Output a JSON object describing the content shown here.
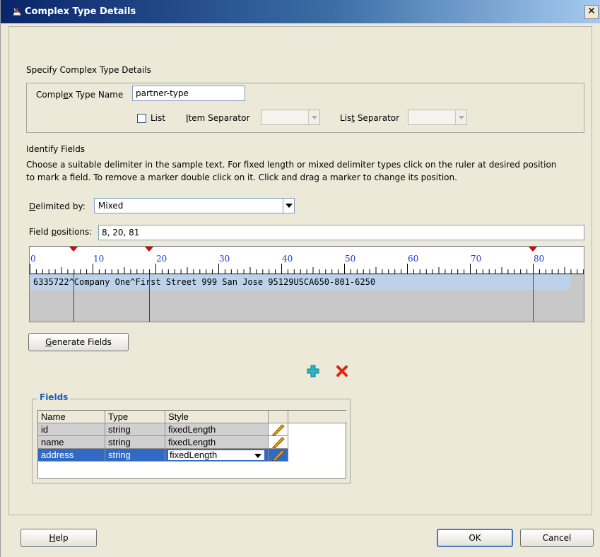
{
  "window": {
    "title": "Complex Type Details",
    "close_glyph": "✕"
  },
  "header": {
    "section_title": "Specify Complex Type Details"
  },
  "complex_type": {
    "name_label": "Complex Type Name",
    "name_value": "partner-type",
    "list_label": "List",
    "list_checked": false,
    "item_separator_label": "Item Separator",
    "item_separator_value": "",
    "list_separator_label": "List Separator",
    "list_separator_value": ""
  },
  "identify": {
    "title": "Identify Fields",
    "instructions_line1": "Choose a suitable delimiter in the sample text. For fixed length or mixed delimiter types click on the ruler at desired position",
    "instructions_line2": "to mark a field. To remove a marker double click on it. Click and drag a marker to change its position.",
    "delimited_by_label": "Delimited by:",
    "delimited_by_value": "Mixed",
    "field_positions_label": "Field positions:",
    "field_positions_value": "8, 20, 81"
  },
  "ruler": {
    "tick_labels": [
      "0",
      "10",
      "20",
      "30",
      "40",
      "50",
      "60",
      "70",
      "80"
    ],
    "sample_text": "6335722^Company One^First Street    999       San Jose       95129USCA650-801-6250",
    "markers": [
      8,
      20,
      81
    ]
  },
  "buttons": {
    "generate_fields": "Generate Fields",
    "help": "Help",
    "ok": "OK",
    "cancel": "Cancel"
  },
  "fields": {
    "legend": "Fields",
    "add_icon": "plus-icon",
    "delete_icon": "delete-x-icon",
    "columns": [
      "Name",
      "Type",
      "Style",
      ""
    ],
    "rows": [
      {
        "name": "id",
        "type": "string",
        "style": "fixedLength",
        "selected": false
      },
      {
        "name": "name",
        "type": "string",
        "style": "fixedLength",
        "selected": false
      },
      {
        "name": "address",
        "type": "string",
        "style": "fixedLength",
        "selected": true
      }
    ]
  },
  "colors": {
    "accent": "#316ac5",
    "marker": "#e00000",
    "tick_label": "#1c38d4",
    "legend": "#1c5fb8"
  }
}
